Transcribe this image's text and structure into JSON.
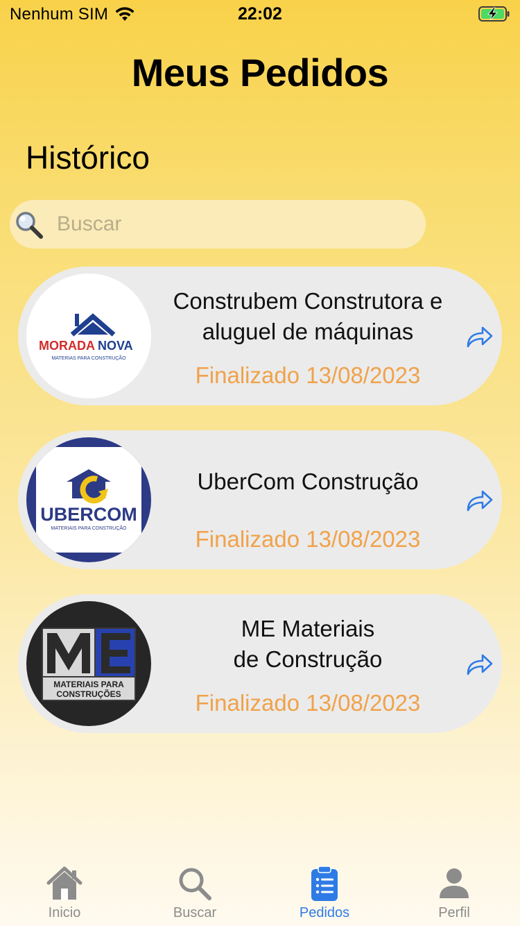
{
  "status_bar": {
    "carrier": "Nenhum SIM",
    "time": "22:02",
    "icons": [
      "wifi-icon",
      "battery-charging-icon"
    ]
  },
  "header": {
    "title": "Meus Pedidos"
  },
  "section": {
    "title": "Histórico"
  },
  "search": {
    "placeholder": "Buscar",
    "value": "",
    "icon": "search-icon"
  },
  "orders": [
    {
      "name": "Construbem Construtora e\naluguel de máquinas",
      "status": "Finalizado 13/08/2023",
      "logo": {
        "brand_top": "MORADA",
        "brand_accent": "NOVA",
        "tagline": "MATERIAS PARA CONSTRUÇÃO"
      }
    },
    {
      "name": "UberCom Construção",
      "status": "Finalizado 13/08/2023",
      "logo": {
        "brand": "UBERCOM",
        "tagline": "MATERIAIS PARA CONSTRUÇÃO"
      }
    },
    {
      "name": "ME Materiais\nde Construção",
      "status": "Finalizado 13/08/2023",
      "logo": {
        "brand": "ME",
        "tagline_1": "MATERIAIS PARA",
        "tagline_2": "CONSTRUÇÕES"
      }
    }
  ],
  "tab_bar": {
    "items": [
      {
        "label": "Inicio",
        "icon": "home-icon",
        "active": false
      },
      {
        "label": "Buscar",
        "icon": "search-icon",
        "active": false
      },
      {
        "label": "Pedidos",
        "icon": "clipboard-list-icon",
        "active": true
      },
      {
        "label": "Perfil",
        "icon": "person-icon",
        "active": false
      }
    ]
  },
  "colors": {
    "background_top": "#f9d24a",
    "background_bottom": "#fffaf0",
    "status_text": "#f0a24a",
    "accent_blue": "#2f7be6",
    "card_bg": "#ebebeb"
  }
}
